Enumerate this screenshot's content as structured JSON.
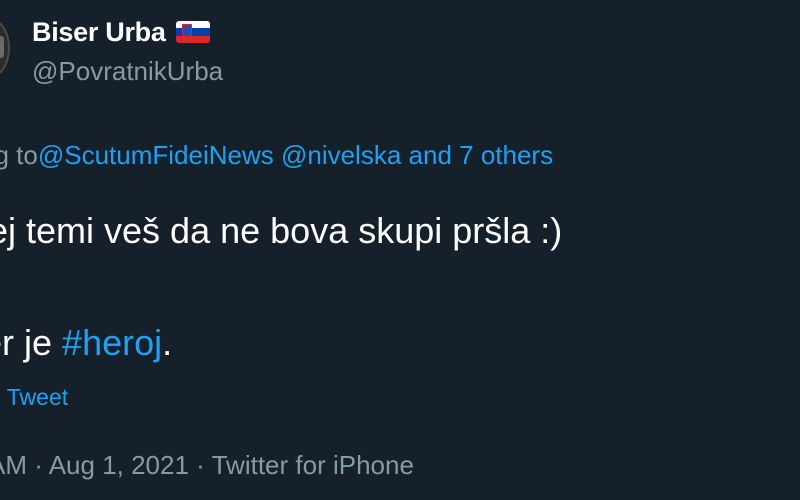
{
  "tweet": {
    "author": {
      "display_name": "Biser Urba",
      "flag_icon": "slovenia-flag-icon",
      "handle": "@PovratnikUrba"
    },
    "replying_prefix": "ng to ",
    "replying_mentions": [
      "@ScutumFideiNews",
      "@nivelska"
    ],
    "replying_others": "and 7 others",
    "line1": "ej temi veš da ne bova skupi pršla :)",
    "line2_prefix": "er je ",
    "line2_hashtag": "#heroj",
    "line2_suffix": ".",
    "translate_label": "e Tweet",
    "meta": {
      "time": "AM",
      "separator": "·",
      "date": "Aug 1, 2021",
      "source": "Twitter for iPhone"
    }
  },
  "colors": {
    "background": "#15202b",
    "primary_text": "#ffffff",
    "secondary_text": "#8899a6",
    "link": "#1da1f2"
  }
}
